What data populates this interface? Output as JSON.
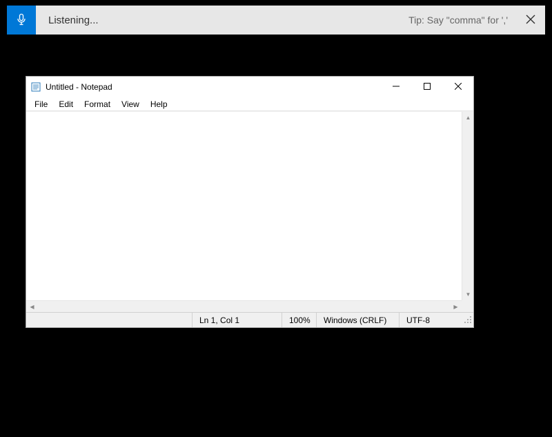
{
  "dictation": {
    "status": "Listening...",
    "tip": "Tip: Say \"comma\" for ','"
  },
  "notepad": {
    "title": "Untitled - Notepad",
    "menu": {
      "file": "File",
      "edit": "Edit",
      "format": "Format",
      "view": "View",
      "help": "Help"
    },
    "content": "",
    "status": {
      "lncol": "Ln 1, Col 1",
      "zoom": "100%",
      "eol": "Windows (CRLF)",
      "encoding": "UTF-8"
    }
  }
}
